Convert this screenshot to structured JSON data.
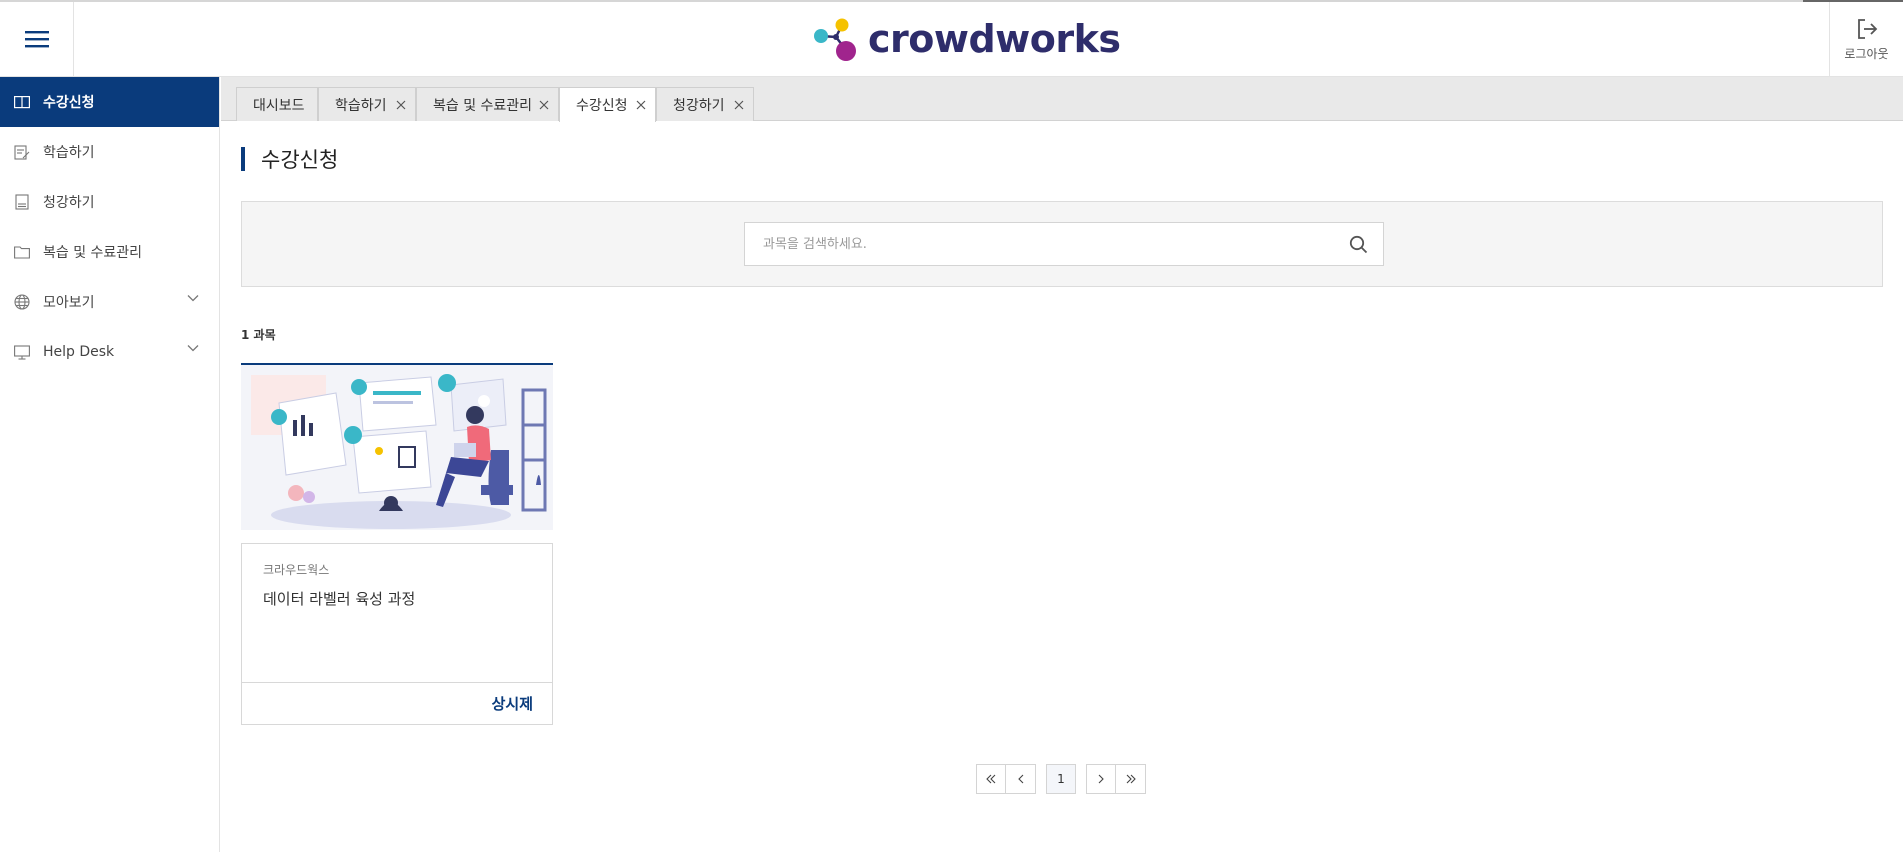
{
  "header": {
    "menu_icon": "hamburger-icon",
    "logo_text": "crowdworks",
    "logout_label": "로그아웃",
    "logout_icon": "logout-icon"
  },
  "sidebar": {
    "items": [
      {
        "label": "수강신청",
        "icon": "book-open-icon",
        "active": true
      },
      {
        "label": "학습하기",
        "icon": "document-edit-icon",
        "active": false
      },
      {
        "label": "청강하기",
        "icon": "document-icon",
        "active": false
      },
      {
        "label": "복습 및 수료관리",
        "icon": "folder-icon",
        "active": false
      },
      {
        "label": "모아보기",
        "icon": "globe-icon",
        "active": false,
        "expandable": true
      },
      {
        "label": "Help Desk",
        "icon": "monitor-icon",
        "active": false,
        "expandable": true
      }
    ]
  },
  "tabs": [
    {
      "label": "대시보드",
      "closable": false,
      "active": false
    },
    {
      "label": "학습하기",
      "closable": true,
      "active": false
    },
    {
      "label": "복습 및 수료관리",
      "closable": true,
      "active": false
    },
    {
      "label": "수강신청",
      "closable": true,
      "active": true
    },
    {
      "label": "청강하기",
      "closable": true,
      "active": false
    }
  ],
  "main": {
    "title": "수강신청",
    "search": {
      "placeholder": "과목을 검색하세요.",
      "value": ""
    },
    "count_text": "1 과목",
    "courses": [
      {
        "provider": "크라우드웍스",
        "title": "데이터 라벨러 육성 과정",
        "status": "상시제"
      }
    ]
  },
  "pagination": {
    "current": "1"
  },
  "colors": {
    "primary": "#0a3b7c",
    "logo_dark": "#2e2d6b",
    "logo_teal": "#3ab7c8",
    "logo_yellow": "#f5c200",
    "logo_purple": "#a0248d"
  }
}
